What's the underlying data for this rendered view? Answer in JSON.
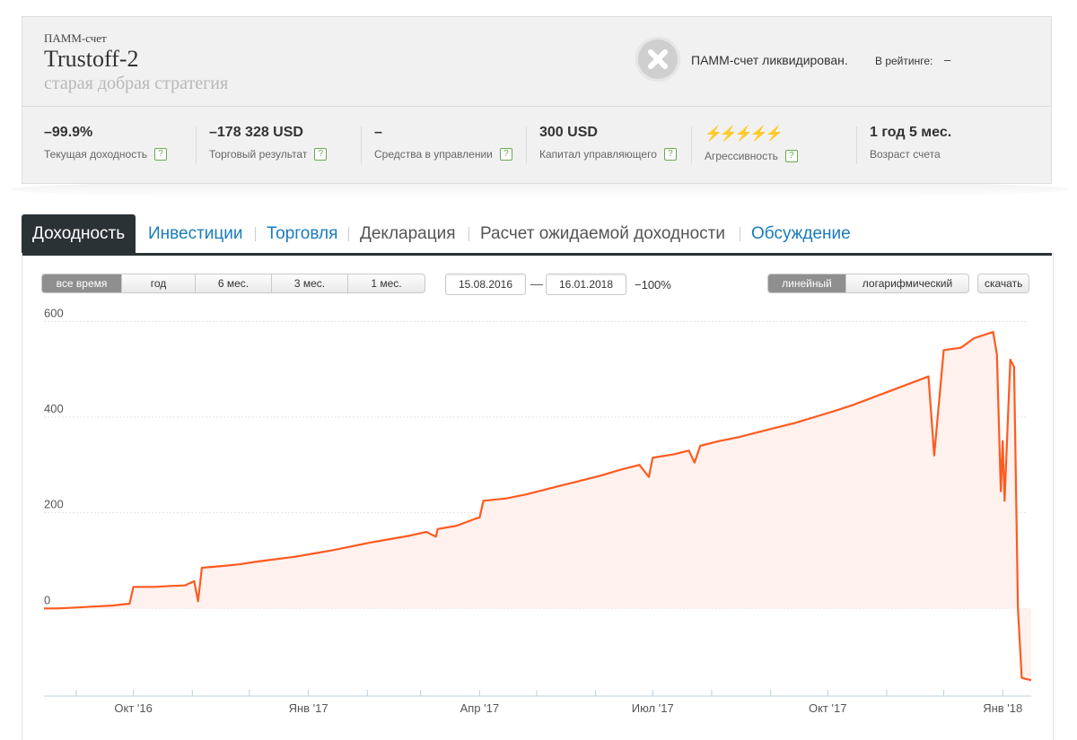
{
  "account": {
    "type_label": "ПАММ-счет",
    "name": "Trustoff-2",
    "subtitle": "старая добрая стратегия",
    "status_text": "ПАММ-счет ликвидирован.",
    "rating_label": "В рейтинге:",
    "rating_value": "–",
    "status_icon": "close-icon"
  },
  "stats": [
    {
      "value": "–99.9%",
      "label": "Текущая доходность",
      "help": "?"
    },
    {
      "value": "–178 328 USD",
      "label": "Торговый результат",
      "help": "?"
    },
    {
      "value": "–",
      "label": "Средства в управлении",
      "help": "?"
    },
    {
      "value": "300 USD",
      "label": "Капитал управляющего",
      "help": "?"
    },
    {
      "value": "⚡⚡⚡⚡⚡",
      "label": "Агрессивность",
      "help": "?",
      "level": 5
    },
    {
      "value": "1 год 5 мес.",
      "label": "Возраст счета"
    }
  ],
  "tabs": [
    {
      "label": "Доходность",
      "active": true
    },
    {
      "label": "Инвестиции"
    },
    {
      "label": "Торговля"
    },
    {
      "label": "Декларация"
    },
    {
      "label": "Расчет ожидаемой доходности"
    },
    {
      "label": "Обсуждение"
    }
  ],
  "period_buttons": [
    "все время",
    "год",
    "6 мес.",
    "3 мес.",
    "1 мес."
  ],
  "period_selected": "все время",
  "date_from": "15.08.2016",
  "date_to": "16.01.2018",
  "date_separator": "—",
  "period_result": "−100%",
  "scale_buttons": [
    "линейный",
    "логарифмический"
  ],
  "scale_selected": "линейный",
  "download_label": "скачать",
  "colors": {
    "line": "#ff5a1f",
    "fill": "#fff1ee",
    "link": "#1a7bbd",
    "tab_active": "#2b3236"
  },
  "chart_data": {
    "type": "area",
    "y_ticks": [
      "600",
      "400",
      "200",
      "0"
    ],
    "ylim": [
      -170,
      640
    ],
    "x_ticks": [
      "Окт '16",
      "Янв '17",
      "Апр '17",
      "Июл '17",
      "Окт '17",
      "Янв '18"
    ],
    "grid": true,
    "series": [
      {
        "points": [
          [
            "2016-08-15",
            0
          ],
          [
            "2016-08-22",
            0
          ],
          [
            "2016-09-01",
            2
          ],
          [
            "2016-09-10",
            4
          ],
          [
            "2016-09-20",
            6
          ],
          [
            "2016-09-29",
            10
          ],
          [
            "2016-10-01",
            45
          ],
          [
            "2016-10-12",
            45
          ],
          [
            "2016-10-20",
            47
          ],
          [
            "2016-10-28",
            48
          ],
          [
            "2016-11-02",
            57
          ],
          [
            "2016-11-04",
            15
          ],
          [
            "2016-11-06",
            85
          ],
          [
            "2016-11-15",
            88
          ],
          [
            "2016-11-25",
            92
          ],
          [
            "2016-12-05",
            98
          ],
          [
            "2016-12-15",
            103
          ],
          [
            "2016-12-25",
            108
          ],
          [
            "2017-01-04",
            115
          ],
          [
            "2017-01-14",
            122
          ],
          [
            "2017-01-24",
            130
          ],
          [
            "2017-02-03",
            138
          ],
          [
            "2017-02-13",
            145
          ],
          [
            "2017-02-23",
            152
          ],
          [
            "2017-03-04",
            160
          ],
          [
            "2017-03-09",
            150
          ],
          [
            "2017-03-10",
            166
          ],
          [
            "2017-03-20",
            173
          ],
          [
            "2017-03-30",
            188
          ],
          [
            "2017-04-01",
            190
          ],
          [
            "2017-04-03",
            225
          ],
          [
            "2017-04-15",
            230
          ],
          [
            "2017-04-25",
            238
          ],
          [
            "2017-05-05",
            248
          ],
          [
            "2017-05-15",
            258
          ],
          [
            "2017-05-25",
            268
          ],
          [
            "2017-06-04",
            278
          ],
          [
            "2017-06-14",
            290
          ],
          [
            "2017-06-24",
            300
          ],
          [
            "2017-06-29",
            275
          ],
          [
            "2017-07-01",
            315
          ],
          [
            "2017-07-12",
            322
          ],
          [
            "2017-07-20",
            330
          ],
          [
            "2017-07-23",
            305
          ],
          [
            "2017-07-26",
            340
          ],
          [
            "2017-08-05",
            350
          ],
          [
            "2017-08-15",
            358
          ],
          [
            "2017-08-25",
            368
          ],
          [
            "2017-09-04",
            378
          ],
          [
            "2017-09-14",
            388
          ],
          [
            "2017-09-24",
            400
          ],
          [
            "2017-10-04",
            412
          ],
          [
            "2017-10-14",
            425
          ],
          [
            "2017-10-24",
            440
          ],
          [
            "2017-11-03",
            455
          ],
          [
            "2017-11-13",
            470
          ],
          [
            "2017-11-23",
            485
          ],
          [
            "2017-11-26",
            320
          ],
          [
            "2017-12-01",
            540
          ],
          [
            "2017-12-10",
            545
          ],
          [
            "2017-12-17",
            565
          ],
          [
            "2017-12-27",
            578
          ],
          [
            "2017-12-29",
            530
          ],
          [
            "2017-12-31",
            245
          ],
          [
            "2018-01-01",
            350
          ],
          [
            "2018-01-02",
            225
          ],
          [
            "2018-01-05",
            520
          ],
          [
            "2018-01-07",
            505
          ],
          [
            "2018-01-09",
            0
          ],
          [
            "2018-01-11",
            -145
          ],
          [
            "2018-01-16",
            -150
          ]
        ]
      }
    ],
    "fill": true
  }
}
